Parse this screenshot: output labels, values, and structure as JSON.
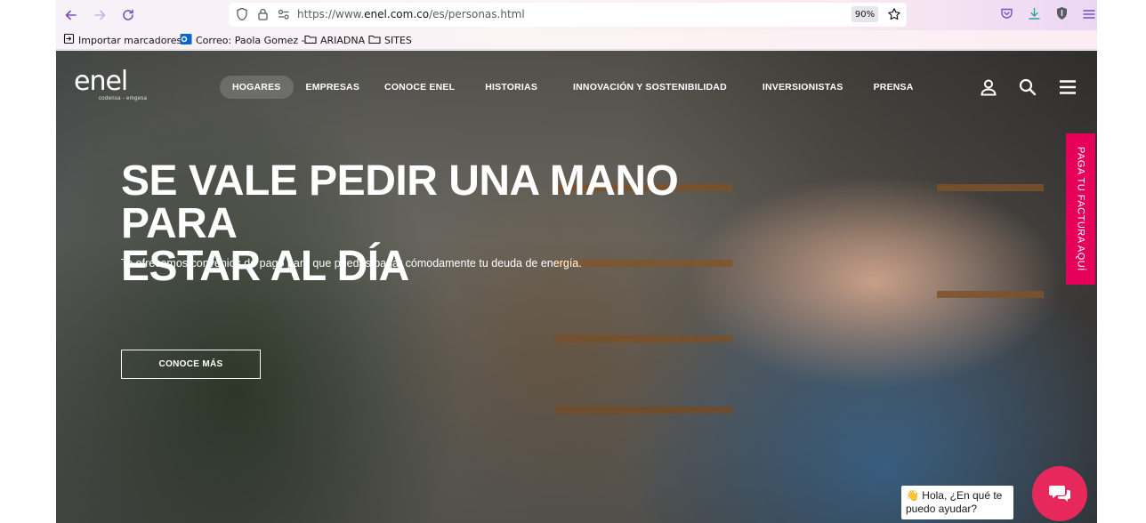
{
  "browser": {
    "url_prefix": "https://www.",
    "url_host": "enel.com.co",
    "url_path": "/es/personas.html",
    "zoom": "90%",
    "bookmarks": [
      {
        "label": "Importar marcadores...",
        "icon": "import-icon"
      },
      {
        "label": "Correo: Paola Gomez -...",
        "icon": "outlook-icon"
      },
      {
        "label": "ARIADNA",
        "icon": "folder-icon"
      },
      {
        "label": "SITES",
        "icon": "folder-icon"
      }
    ]
  },
  "site": {
    "logo_text": "enel",
    "logo_subtext": "codensa - emgesa",
    "nav": [
      "HOGARES",
      "EMPRESAS",
      "CONOCE ENEL",
      "HISTORIAS",
      "INNOVACIÓN Y SOSTENIBILIDAD",
      "INVERSIONISTAS",
      "PRENSA"
    ],
    "active_nav": "HOGARES"
  },
  "hero": {
    "headline_line1": "SE VALE PEDIR UNA MANO PARA",
    "headline_line2": "ESTAR AL DÍA",
    "subheadline": "Te ofrecemos convenios de pago para que puedas pagar cómodamente tu deuda de energía.",
    "cta_label": "CONOCE MÁS"
  },
  "side_tab": {
    "label": "PAGA TU FACTURA AQUÍ"
  },
  "chat": {
    "emoji": "👋",
    "line1": "Hola, ¿En qué te",
    "line2": "puedo ayudar?"
  },
  "colors": {
    "accent_pink": "#e6005a",
    "chat_pink": "#e6285a",
    "browser_icon_purple": "#7d4fc2"
  }
}
